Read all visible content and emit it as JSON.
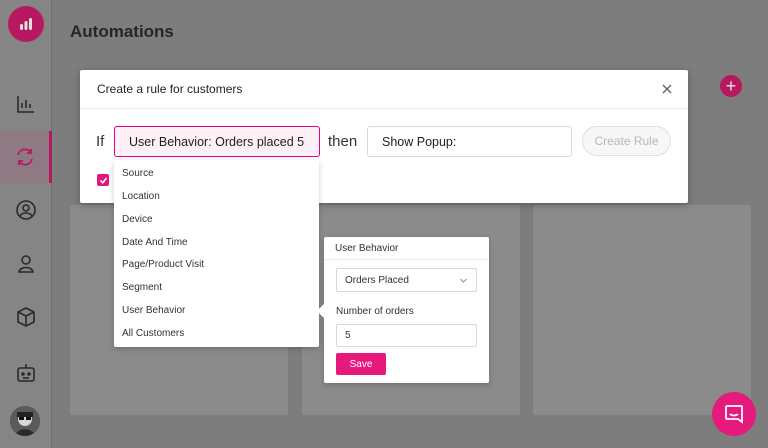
{
  "page": {
    "title": "Automations"
  },
  "modal": {
    "title": "Create a rule for customers",
    "if_label": "If",
    "then_label": "then",
    "condition_value": "User Behavior: Orders placed 5",
    "action_value": "Show Popup:",
    "create_button": "Create Rule"
  },
  "dropdown": {
    "options": [
      "Source",
      "Location",
      "Device",
      "Date And Time",
      "Page/Product Visit",
      "Segment",
      "User Behavior",
      "All Customers"
    ]
  },
  "popover": {
    "title": "User Behavior",
    "select_value": "Orders Placed",
    "number_label": "Number of orders",
    "number_value": "5",
    "save_label": "Save"
  },
  "colors": {
    "brand": "#e6197c",
    "brand_dim": "#b6195f"
  },
  "icons": {
    "logo": "bar-chart-logo-icon",
    "nav": [
      "analytics-icon",
      "automations-sync-icon",
      "customers-icon",
      "visitors-icon",
      "products-box-icon",
      "bot-icon"
    ],
    "chat": "chat-bubble-icon"
  }
}
